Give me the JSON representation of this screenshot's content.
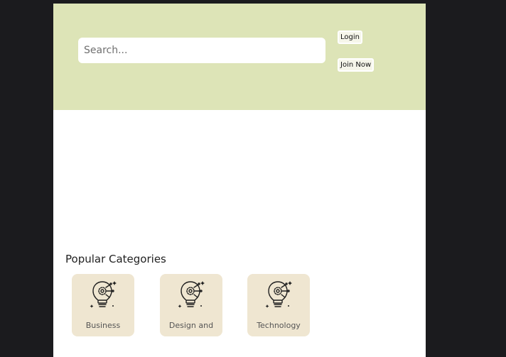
{
  "header": {
    "search": {
      "placeholder": "Search...",
      "value": ""
    },
    "login_label": "Login",
    "join_label": "Join Now"
  },
  "categories": {
    "title": "Popular Categories",
    "items": [
      {
        "label": "Business",
        "icon": "lightbulb-gear-icon"
      },
      {
        "label": "Design and",
        "icon": "lightbulb-gear-icon"
      },
      {
        "label": "Technology",
        "icon": "lightbulb-gear-icon"
      }
    ]
  },
  "colors": {
    "background": "#1b1b1e",
    "header_bg": "#dde4b7",
    "card_bg": "#efe6d1",
    "page_bg": "#ffffff"
  }
}
